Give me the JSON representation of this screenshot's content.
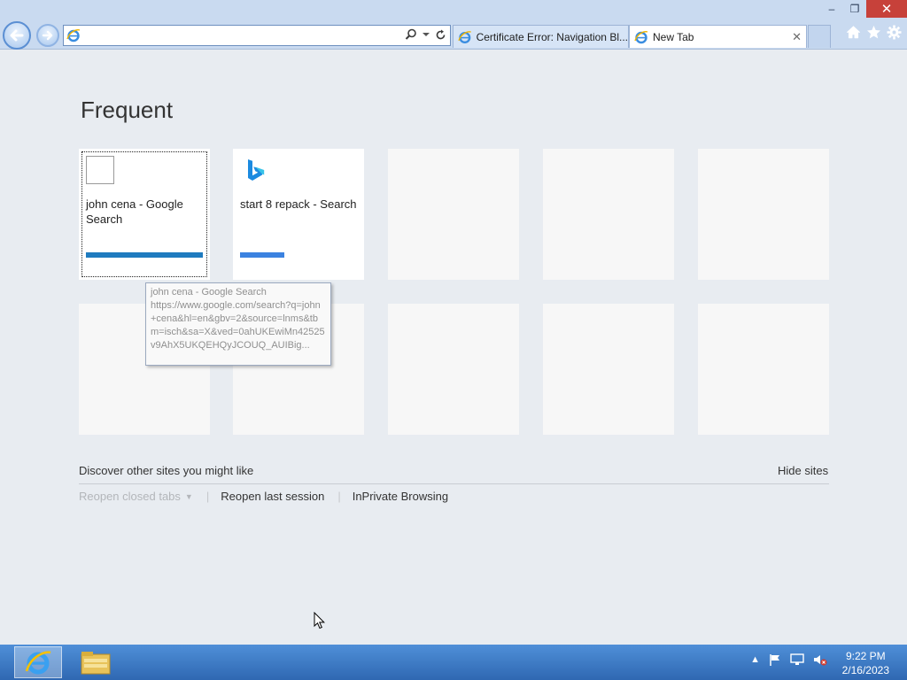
{
  "window": {
    "minimize_label": "–",
    "restore_label": "❐",
    "close_label": "✕"
  },
  "address_bar": {
    "value": "",
    "placeholder": ""
  },
  "tabs": [
    {
      "label": "Certificate Error: Navigation Bl...",
      "active": false
    },
    {
      "label": "New Tab",
      "active": true,
      "close": "✕"
    }
  ],
  "new_tab_page": {
    "heading": "Frequent",
    "tiles": [
      {
        "title": "john cena - Google Search",
        "bar_color": "#1f7bbf",
        "icon": "blank-page-icon"
      },
      {
        "title": "start 8 repack - Search",
        "bar_color": "#3b82e0",
        "icon": "bing-icon"
      }
    ],
    "tooltip": {
      "title": "john cena - Google Search",
      "url": "https://www.google.com/search?q=john+cena&hl=en&gbv=2&source=lnms&tbm=isch&sa=X&ved=0ahUKEwiMn42525v9AhX5UKQEHQyJCOUQ_AUIBig..."
    },
    "discover_label": "Discover other sites you might like",
    "hide_sites_label": "Hide sites",
    "reopen_closed_tabs_label": "Reopen closed tabs",
    "reopen_last_session_label": "Reopen last session",
    "inprivate_label": "InPrivate Browsing"
  },
  "taskbar": {
    "time": "9:22 PM",
    "date": "2/16/2023"
  },
  "colors": {
    "accent": "#3b82e0",
    "taskbar": "#3d7bc6"
  }
}
